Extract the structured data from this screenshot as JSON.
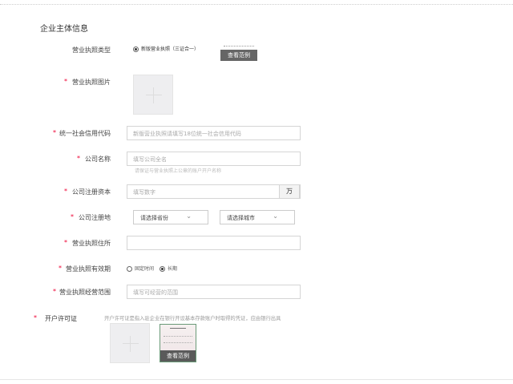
{
  "section_title": "企业主体信息",
  "fields": {
    "license_type": {
      "label": "营业执照类型",
      "option": "新版营业执照（三证合一）",
      "sample": "查看范例"
    },
    "license_image": {
      "label": "营业执照图片"
    },
    "credit_code": {
      "label": "统一社会信用代码",
      "placeholder": "新版营业执照请填写18位统一社会信用代码"
    },
    "company_name": {
      "label": "公司名称",
      "placeholder": "填写公司全名",
      "hint": "请保证与营业执照上公章的账户开户名称"
    },
    "capital": {
      "label": "公司注册资本",
      "placeholder": "填写数字",
      "unit": "万"
    },
    "location": {
      "label": "公司注册地",
      "province": "请选择省份",
      "city": "请选择城市"
    },
    "address": {
      "label": "营业执照住所",
      "value": ""
    },
    "validity": {
      "label": "营业执照有效期",
      "options": [
        "固定时间",
        "长期"
      ],
      "selected": "长期"
    },
    "scope": {
      "label": "营业执照经营范围",
      "placeholder": "填写可经营的范围"
    },
    "permit": {
      "label": "开户许可证",
      "description": "开户许可证是指入驻企业在银行开设基本存款账户时取得的凭证，应由银行出具",
      "sample": "查看范例"
    }
  },
  "required_mark": "*"
}
